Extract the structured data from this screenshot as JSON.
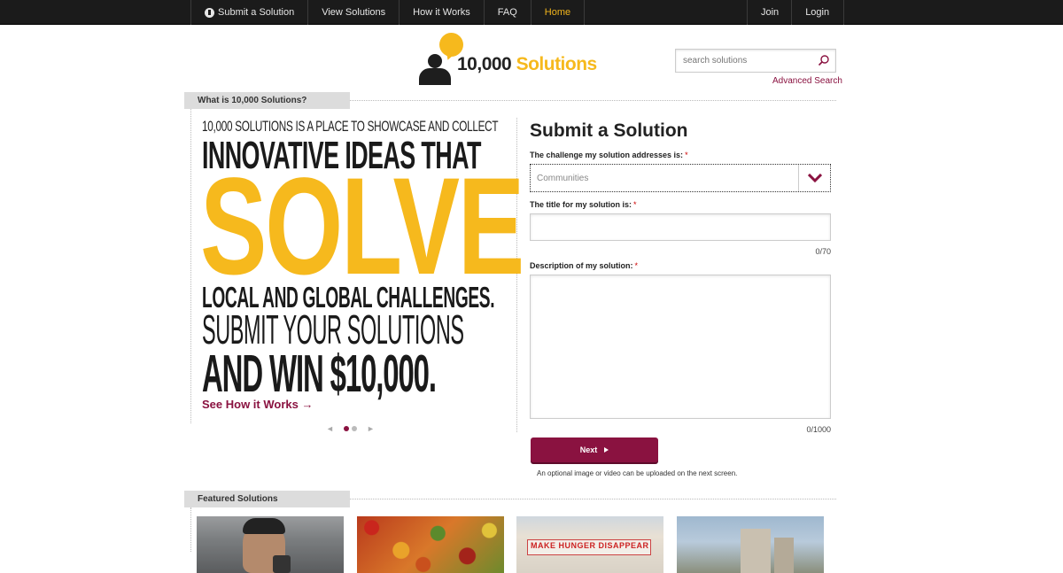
{
  "nav": {
    "items": [
      {
        "label": "Submit a Solution",
        "icon": "lightbulb-icon"
      },
      {
        "label": "View Solutions"
      },
      {
        "label": "How it Works"
      },
      {
        "label": "FAQ"
      },
      {
        "label": "Home",
        "active": true
      }
    ],
    "account": [
      {
        "label": "Join"
      },
      {
        "label": "Login"
      }
    ]
  },
  "logo": {
    "part1": "10,000",
    "part2": " Solutions"
  },
  "search": {
    "placeholder": "search solutions",
    "advanced_label": "Advanced Search"
  },
  "intro_tab": "What is 10,000 Solutions?",
  "hero": {
    "line1": "10,000 SOLUTIONS IS A PLACE TO SHOWCASE AND COLLECT",
    "line2": "INNOVATIVE IDEAS THAT",
    "line3": "SOLVE",
    "line4": "LOCAL AND GLOBAL CHALLENGES.",
    "line5": "SUBMIT YOUR SOLUTIONS",
    "line6": "AND WIN $10,000.",
    "cta": "See How it Works →"
  },
  "pager": {
    "prev": "◄",
    "next": "►",
    "count": 2,
    "active": 1
  },
  "form": {
    "title": "Submit a Solution",
    "challenge_label": "The challenge my solution addresses is:",
    "challenge_value": "Communities",
    "title_label": "The title for my solution is:",
    "title_value": "",
    "title_counter": "0/70",
    "description_label": "Description of my solution:",
    "description_value": "",
    "description_counter": "0/1000",
    "required_mark": "*",
    "next_label": "Next",
    "note": "An optional image or video can be uploaded on the next screen."
  },
  "featured_tab": "Featured Solutions",
  "featured": [
    {
      "image": "man-speaking-thumb"
    },
    {
      "image": "peppers-thumb"
    },
    {
      "image": "make-hunger-disappear-thumb",
      "caption": "MAKE HUNGER DISAPPEAR"
    },
    {
      "image": "city-buildings-thumb"
    }
  ],
  "colors": {
    "accent": "#8a1240",
    "brand_yellow": "#f6b91d",
    "nav_bg": "#1b1b1b",
    "nav_active": "#f2b51c"
  }
}
